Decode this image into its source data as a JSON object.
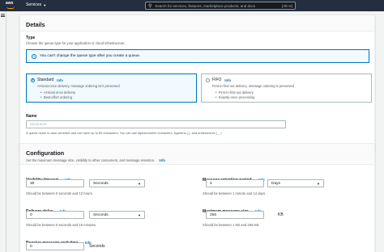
{
  "topnav": {
    "logo_text": "aws",
    "services_label": "Services",
    "search_placeholder": "Search for services, features, marketplace products, and docs",
    "search_shortcut": "[Alt+S]"
  },
  "details": {
    "title": "Details",
    "type_label": "Type",
    "type_hint": "Choose the queue type for your application or cloud infrastructure.",
    "alert_text": "You can't change the queue type after you create a queue.",
    "standard": {
      "title": "Standard",
      "info": "Info",
      "subtitle": "At-least-once delivery, message ordering isn't preserved",
      "bullets": [
        "At-least once delivery",
        "Best-effort ordering"
      ],
      "selected": true
    },
    "fifo": {
      "title": "FIFO",
      "info": "Info",
      "subtitle": "First-in-first-out delivery, message ordering is preserved",
      "bullets": [
        "First-in-first-out delivery",
        "Exactly-once processing"
      ],
      "selected": false
    },
    "name_label": "Name",
    "name_placeholder": "MyQueue",
    "name_hint": "A queue name is case-sensitive and can have up to 80 characters. You can use alphanumeric characters, hyphens (-), and underscores ( _ )."
  },
  "configuration": {
    "title": "Configuration",
    "info": "Info",
    "description": "Set the maximum message size, visibility to other consumers, and message retention.",
    "visibility_timeout": {
      "label": "Visibility timeout",
      "info": "Info",
      "value": "30",
      "unit": "Seconds",
      "hint": "Should be between 0 seconds and 12 hours."
    },
    "message_retention": {
      "label": "Message retention period",
      "info": "Info",
      "value": "4",
      "unit": "Days",
      "hint": "Should be between 1 minute and 14 days."
    },
    "delivery_delay": {
      "label": "Delivery delay",
      "info": "Info",
      "value": "0",
      "unit": "Seconds",
      "hint": "Should be between 0 seconds and 15 minutes."
    },
    "max_message_size": {
      "label": "Maximum message size",
      "info": "Info",
      "value": "256",
      "unit": "KB",
      "hint": "Should be between 1 KB and 256 KB."
    },
    "receive_wait": {
      "label": "Receive message wait time",
      "info": "Info",
      "value": "0",
      "unit": "Seconds"
    }
  },
  "colors": {
    "nav_bg": "#232f3e",
    "accent": "#0073bb",
    "orange": "#ff9900",
    "page_bg": "#f2f3f3"
  }
}
